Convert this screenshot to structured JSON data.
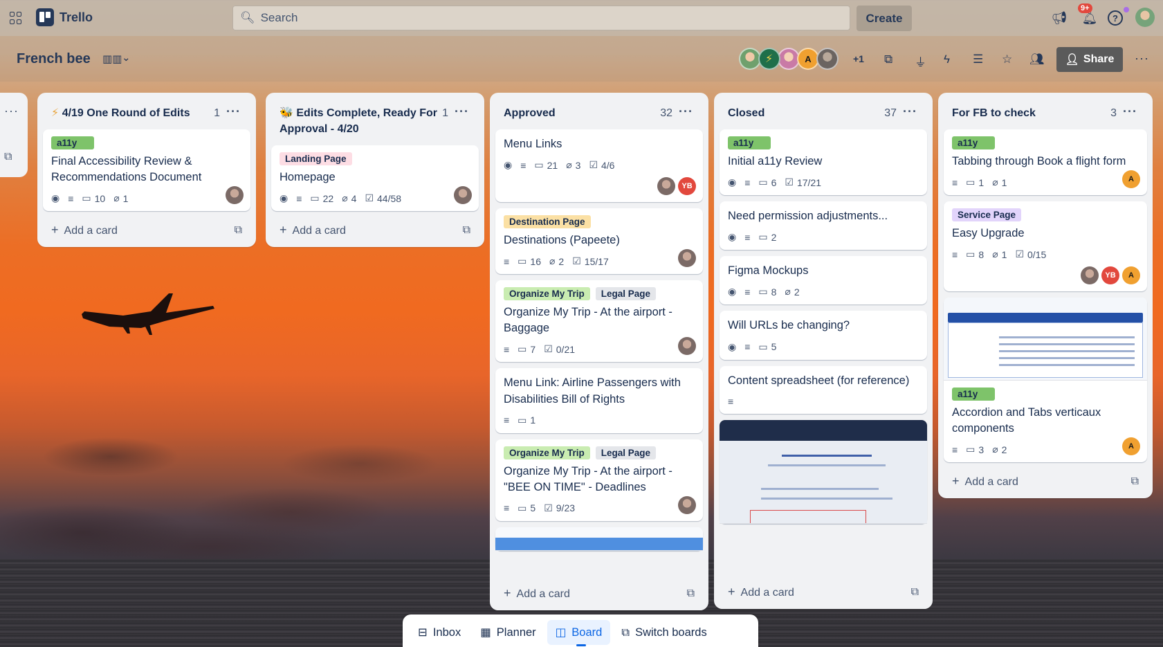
{
  "topbar": {
    "app_name": "Trello",
    "search_placeholder": "Search",
    "create_label": "Create",
    "notification_count": "9+"
  },
  "board": {
    "title": "French bee",
    "members_extra": "+1",
    "member_initial": "A",
    "share_label": "Share"
  },
  "lists": [
    {
      "title": "4/19 One Round of Edits",
      "prefix_icon": "⚡",
      "count": "1",
      "cards": [
        {
          "labels": [
            "a11y"
          ],
          "title": "Final Accessibility Review & Recommendations Document",
          "comments": "10",
          "attachments": "1"
        }
      ],
      "add_label": "Add a card"
    },
    {
      "title": "Edits Complete, Ready For Approval - 4/20",
      "prefix_icon": "🐝",
      "count": "1",
      "cards": [
        {
          "labels": [
            "Landing Page"
          ],
          "title": "Homepage",
          "comments": "22",
          "attachments": "4",
          "checklist": "44/58"
        }
      ],
      "add_label": "Add a card"
    },
    {
      "title": "Approved",
      "count": "32",
      "cards": [
        {
          "title": "Menu Links",
          "comments": "21",
          "attachments": "3",
          "checklist": "4/6",
          "member": "YB"
        },
        {
          "labels": [
            "Destination Page"
          ],
          "title": "Destinations (Papeete)",
          "comments": "16",
          "attachments": "2",
          "checklist": "15/17"
        },
        {
          "labels": [
            "Organize My Trip",
            "Legal Page"
          ],
          "title": "Organize My Trip - At the airport - Baggage",
          "comments": "7",
          "checklist": "0/21"
        },
        {
          "title": "Menu Link: Airline Passengers with Disabilities Bill of Rights",
          "comments": "1"
        },
        {
          "labels": [
            "Organize My Trip",
            "Legal Page"
          ],
          "title": "Organize My Trip - At the airport  - \"BEE ON TIME\" - Deadlines",
          "comments": "5",
          "checklist": "9/23"
        }
      ],
      "add_label": "Add a card"
    },
    {
      "title": "Closed",
      "count": "37",
      "cards": [
        {
          "labels": [
            "a11y"
          ],
          "title": "Initial a11y Review",
          "comments": "6",
          "checklist": "17/21"
        },
        {
          "title": "Need permission adjustments...",
          "comments": "2"
        },
        {
          "title": "Figma Mockups",
          "comments": "8",
          "attachments": "2"
        },
        {
          "title": "Will URLs be changing?",
          "comments": "5"
        },
        {
          "title": "Content spreadsheet (for reference)"
        }
      ],
      "add_label": "Add a card"
    },
    {
      "title": "For FB to check",
      "count": "3",
      "cards": [
        {
          "labels": [
            "a11y"
          ],
          "title": "Tabbing through Book a flight form",
          "comments": "1",
          "attachments": "1",
          "member": "A"
        },
        {
          "labels": [
            "Service Page"
          ],
          "title": "Easy Upgrade",
          "comments": "8",
          "attachments": "1",
          "checklist": "0/15",
          "members": [
            "YB",
            "A"
          ]
        },
        {
          "labels": [
            "a11y"
          ],
          "title": "Accordion and Tabs verticaux components",
          "comments": "3",
          "attachments": "2",
          "member": "A"
        }
      ],
      "add_label": "Add a card"
    }
  ],
  "switcher": {
    "inbox": "Inbox",
    "planner": "Planner",
    "board": "Board",
    "switch": "Switch boards"
  },
  "colors": {
    "accent": "#0c66e4",
    "label_green": "#7ec36a",
    "avatar_yb": "#e2483d",
    "avatar_a": "#f0a030"
  }
}
